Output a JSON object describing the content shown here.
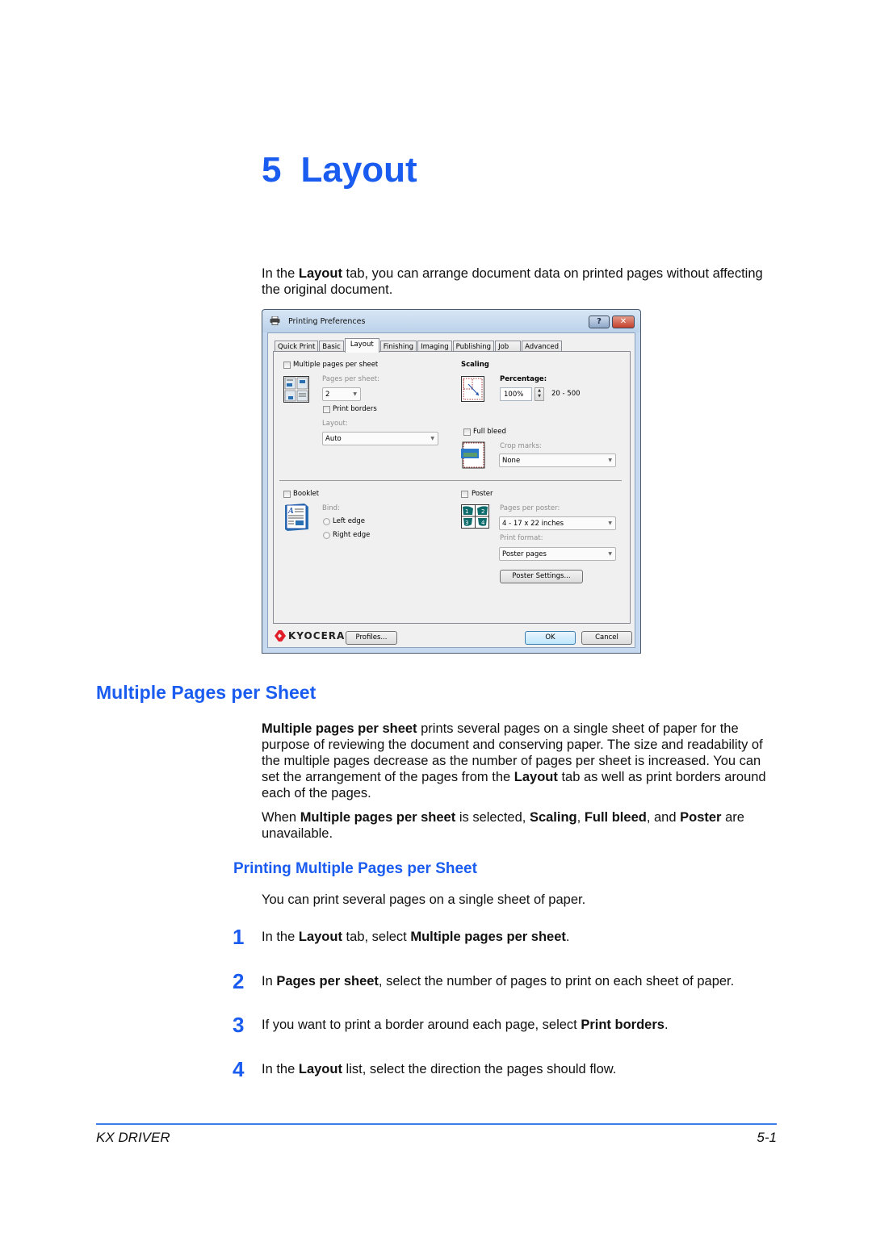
{
  "chapter": {
    "number": "5",
    "title": "Layout"
  },
  "intro": {
    "before": "In the ",
    "bold1": "Layout",
    "after": " tab, you can arrange document data on printed pages without affecting the original document."
  },
  "dialog": {
    "title": "Printing Preferences",
    "help_label": "?",
    "close_label": "✕",
    "tabs": [
      "Quick Print",
      "Basic",
      "Layout",
      "Finishing",
      "Imaging",
      "Publishing",
      "Job",
      "Advanced"
    ],
    "active_tab": "Layout",
    "multiple_pages": {
      "label": "Multiple pages per sheet",
      "checked": false,
      "pages_per_sheet_label": "Pages per sheet:",
      "pages_per_sheet_value": "2",
      "print_borders_label": "Print borders",
      "layout_label": "Layout:",
      "layout_value": "Auto"
    },
    "scaling": {
      "label": "Scaling",
      "percentage_label": "Percentage:",
      "percentage_value": "100%",
      "range": "20 - 500"
    },
    "full_bleed": {
      "label": "Full bleed",
      "crop_marks_label": "Crop marks:",
      "crop_marks_value": "None"
    },
    "booklet": {
      "label": "Booklet",
      "bind_label": "Bind:",
      "left_edge": "Left edge",
      "right_edge": "Right edge"
    },
    "poster": {
      "label": "Poster",
      "pages_per_poster_label": "Pages per poster:",
      "pages_per_poster_value": "4 - 17 x 22 inches",
      "print_format_label": "Print format:",
      "print_format_value": "Poster pages",
      "settings_button": "Poster Settings..."
    },
    "footer": {
      "brand": "KYOCERA",
      "profiles_button": "Profiles...",
      "ok_button": "OK",
      "cancel_button": "Cancel"
    }
  },
  "section": {
    "heading": "Multiple Pages per Sheet",
    "p1": {
      "b1": "Multiple pages per sheet",
      "t1": " prints several pages on a single sheet of paper for the purpose of reviewing the document and conserving paper. The size and readability of the multiple pages decrease as the number of pages per sheet is increased. You can set the arrangement of the pages from the ",
      "b2": "Layout",
      "t2": " tab as well as print borders around each of the pages."
    },
    "p2": {
      "t0": "When ",
      "b1": "Multiple pages per sheet",
      "t1": " is selected, ",
      "b2": "Scaling",
      "t2": ", ",
      "b3": "Full bleed",
      "t3": ", and ",
      "b4": "Poster",
      "t4": " are unavailable."
    }
  },
  "subsection": {
    "heading": "Printing Multiple Pages per Sheet",
    "intro": "You can print several pages on a single sheet of paper.",
    "steps": [
      {
        "num": "1",
        "t0": "In the ",
        "b1": "Layout",
        "t1": " tab, select ",
        "b2": "Multiple pages per sheet",
        "t2": "."
      },
      {
        "num": "2",
        "t0": "In ",
        "b1": "Pages per sheet",
        "t1": ", select the number of pages to print on each sheet of paper.",
        "b2": "",
        "t2": ""
      },
      {
        "num": "3",
        "t0": "If you want to print a border around each page, select ",
        "b1": "Print borders",
        "t1": ".",
        "b2": "",
        "t2": ""
      },
      {
        "num": "4",
        "t0": "In the ",
        "b1": "Layout",
        "t1": " list, select the direction the pages should flow.",
        "b2": "",
        "t2": ""
      }
    ]
  },
  "footer": {
    "left": "KX DRIVER",
    "right": "5-1"
  },
  "colors": {
    "heading_blue": "#1a5cf0",
    "rule_blue": "#3d7be8"
  }
}
